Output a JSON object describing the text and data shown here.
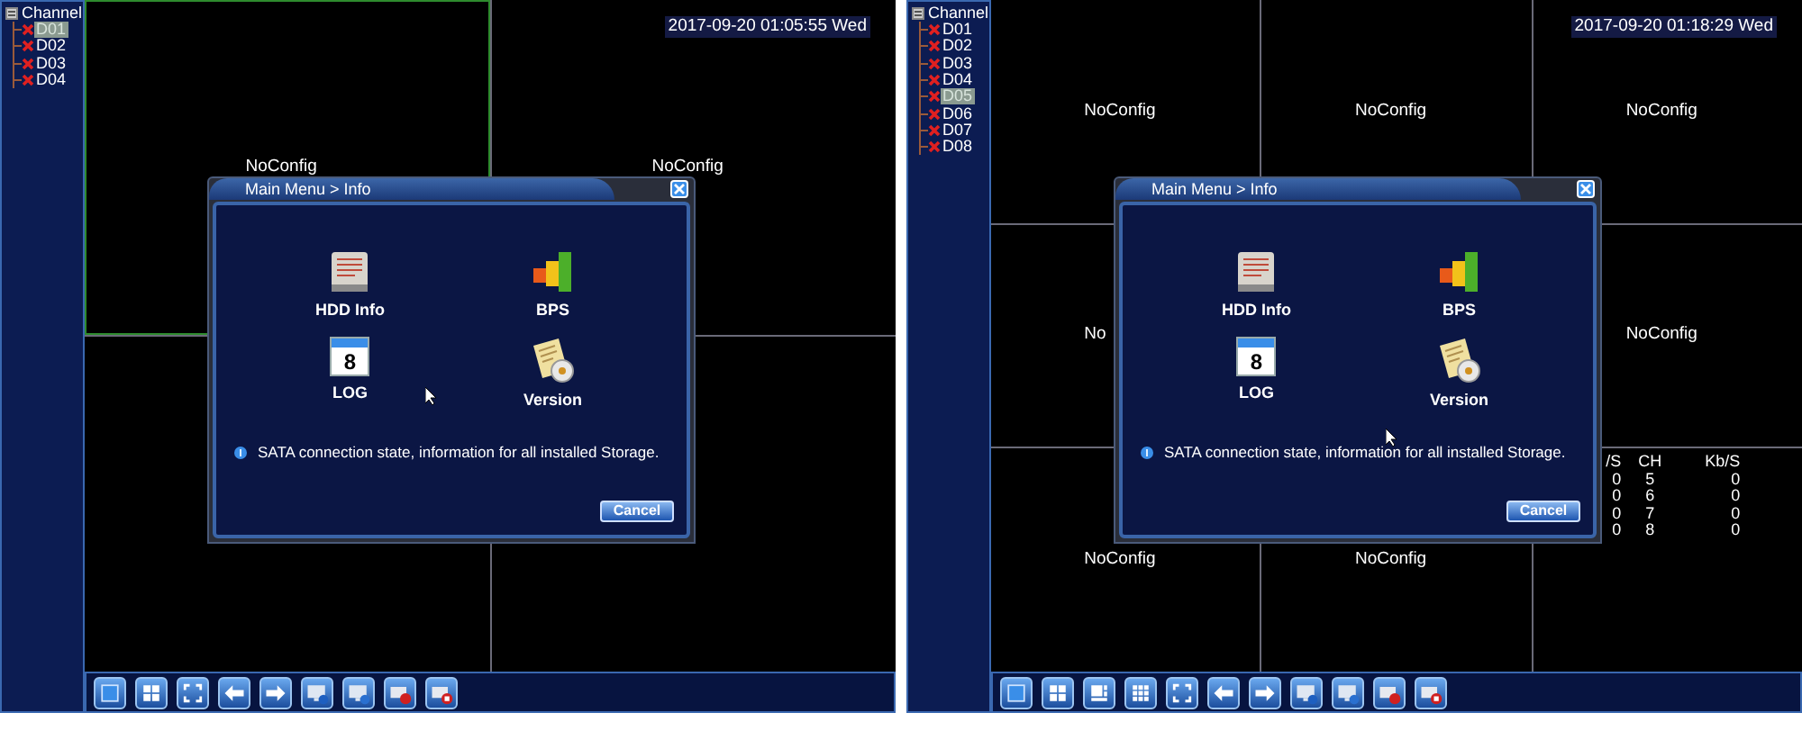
{
  "panels": [
    {
      "sidebar": {
        "title": "Channel",
        "channels": [
          {
            "label": "D01",
            "selected": true
          },
          {
            "label": "D02",
            "selected": false
          },
          {
            "label": "D03",
            "selected": false
          },
          {
            "label": "D04",
            "selected": false
          }
        ]
      },
      "kind": "quad",
      "timestamp": "2017-09-20 01:05:55 Wed",
      "cells": [
        {
          "label": "NoConfig",
          "selected": true
        },
        {
          "label": "NoConfig",
          "selected": false
        },
        {
          "selected": false
        },
        {
          "selected": false
        }
      ],
      "dialog": {
        "title": "Main Menu > Info",
        "items": [
          {
            "kind": "hdd",
            "label": "HDD Info"
          },
          {
            "kind": "bps",
            "label": "BPS"
          },
          {
            "kind": "log",
            "label": "LOG",
            "icon_text": "8"
          },
          {
            "kind": "version",
            "label": "Version"
          }
        ],
        "info": "SATA connection state, information for all installed Storage.",
        "cancel": "Cancel"
      },
      "toolbar": [
        {
          "kind": "single"
        },
        {
          "kind": "quad"
        },
        {
          "kind": "fullscreen"
        },
        {
          "kind": "prev"
        },
        {
          "kind": "next"
        },
        {
          "kind": "monitor-play"
        },
        {
          "kind": "monitor"
        },
        {
          "kind": "record"
        },
        {
          "kind": "record-stop"
        }
      ]
    },
    {
      "sidebar": {
        "title": "Channel",
        "channels": [
          {
            "label": "D01",
            "selected": false
          },
          {
            "label": "D02",
            "selected": false
          },
          {
            "label": "D03",
            "selected": false
          },
          {
            "label": "D04",
            "selected": false
          },
          {
            "label": "D05",
            "selected": true
          },
          {
            "label": "D06",
            "selected": false
          },
          {
            "label": "D07",
            "selected": false
          },
          {
            "label": "D08",
            "selected": false
          }
        ]
      },
      "kind": "nine",
      "timestamp": "2017-09-20 01:18:29 Wed",
      "cells": [
        {
          "label": "NoConfig",
          "selected": false
        },
        {
          "label": "NoConfig",
          "selected": false
        },
        {
          "label": "NoConfig",
          "selected": false
        },
        {
          "label": "No",
          "selected": false
        },
        {},
        {
          "label": "NoConfig",
          "selected": false
        },
        {
          "label": "NoConfig",
          "selected": false
        },
        {
          "label": "NoConfig",
          "selected": false
        },
        {
          "selected": false,
          "bps_table": {
            "columns": [
              "/S",
              "CH",
              "Kb/S"
            ],
            "rows": [
              [
                "0",
                "5",
                "0"
              ],
              [
                "0",
                "6",
                "0"
              ],
              [
                "0",
                "7",
                "0"
              ],
              [
                "0",
                "8",
                "0"
              ]
            ]
          }
        }
      ],
      "dialog": {
        "title": "Main Menu > Info",
        "items": [
          {
            "kind": "hdd",
            "label": "HDD Info"
          },
          {
            "kind": "bps",
            "label": "BPS"
          },
          {
            "kind": "log",
            "label": "LOG",
            "icon_text": "8"
          },
          {
            "kind": "version",
            "label": "Version"
          }
        ],
        "info": "SATA connection state, information for all installed Storage.",
        "cancel": "Cancel"
      },
      "toolbar": [
        {
          "kind": "single"
        },
        {
          "kind": "quad"
        },
        {
          "kind": "six"
        },
        {
          "kind": "nine"
        },
        {
          "kind": "fullscreen"
        },
        {
          "kind": "prev"
        },
        {
          "kind": "next"
        },
        {
          "kind": "monitor-play"
        },
        {
          "kind": "monitor"
        },
        {
          "kind": "record"
        },
        {
          "kind": "record-stop"
        }
      ]
    }
  ]
}
